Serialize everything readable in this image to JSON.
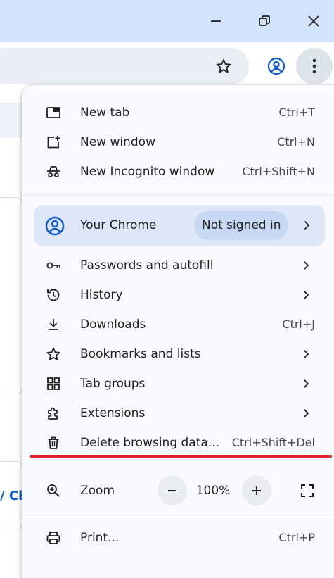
{
  "window_controls": {
    "minimize_icon": "minimize-icon",
    "restore_icon": "restore-icon",
    "close_icon": "close-icon"
  },
  "toolbar": {
    "bookmark_icon": "star-icon",
    "profile_icon": "account-icon",
    "menu_icon": "three-dot-menu-icon"
  },
  "background": {
    "partial_text": "/ Ch"
  },
  "menu": {
    "group1": [
      {
        "label": "New tab",
        "shortcut": "Ctrl+T",
        "icon": "new-tab-icon"
      },
      {
        "label": "New window",
        "shortcut": "Ctrl+N",
        "icon": "new-window-icon"
      },
      {
        "label": "New Incognito window",
        "shortcut": "Ctrl+Shift+N",
        "icon": "incognito-icon"
      }
    ],
    "profile": {
      "label": "Your Chrome",
      "status": "Not signed in",
      "icon": "account-circle-icon"
    },
    "group2": [
      {
        "label": "Passwords and autofill",
        "shortcut": "",
        "icon": "key-icon"
      },
      {
        "label": "History",
        "shortcut": "",
        "icon": "history-icon"
      },
      {
        "label": "Downloads",
        "shortcut": "Ctrl+J",
        "icon": "download-icon"
      },
      {
        "label": "Bookmarks and lists",
        "shortcut": "",
        "icon": "star-icon"
      },
      {
        "label": "Tab groups",
        "shortcut": "",
        "icon": "tab-groups-icon"
      },
      {
        "label": "Extensions",
        "shortcut": "",
        "icon": "extension-icon"
      },
      {
        "label": "Delete browsing data...",
        "shortcut": "Ctrl+Shift+Del",
        "icon": "trash-icon"
      }
    ],
    "zoom": {
      "label": "Zoom",
      "value": "100%"
    },
    "print": {
      "label": "Print...",
      "shortcut": "Ctrl+P",
      "icon": "print-icon"
    }
  },
  "colors": {
    "titlebar": "#d3e3fd",
    "menu_bg": "#f8fafd",
    "highlight_line": "#e3202e",
    "accent": "#0b57d0"
  }
}
